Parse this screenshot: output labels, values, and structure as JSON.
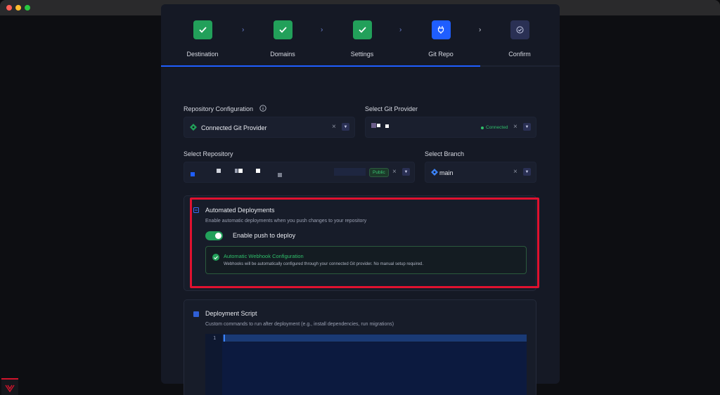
{
  "stepper": {
    "steps": [
      {
        "label": "Destination",
        "state": "done"
      },
      {
        "label": "Domains",
        "state": "done"
      },
      {
        "label": "Settings",
        "state": "done"
      },
      {
        "label": "Git Repo",
        "state": "active"
      },
      {
        "label": "Confirm",
        "state": "todo"
      }
    ],
    "separator": "›",
    "progress_fraction": 0.8
  },
  "repo_config": {
    "label": "Repository Configuration",
    "value": "Connected Git Provider",
    "info_icon": "info-icon",
    "clear_glyph": "×",
    "dropdown_glyph": "▼"
  },
  "git_provider": {
    "label": "Select Git Provider",
    "status": "Connected"
  },
  "repository": {
    "label": "Select Repository",
    "visibility": "Public"
  },
  "branch": {
    "label": "Select Branch",
    "value": "main"
  },
  "automated_deployments": {
    "title": "Automated Deployments",
    "description": "Enable automatic deployments when you push changes to your repository",
    "toggle_label": "Enable push to deploy",
    "toggle_on": true,
    "webhook_title": "Automatic Webhook Configuration",
    "webhook_desc": "Webhooks will be automatically configured through your connected Git provider. No manual setup required."
  },
  "deployment_script": {
    "title": "Deployment Script",
    "description": "Custom commands to run after deployment (e.g., install dependencies, run migrations)",
    "line_numbers": [
      "1"
    ]
  },
  "colors": {
    "accent": "#1f5eff",
    "success": "#22a05a",
    "highlight": "#e0112f"
  }
}
